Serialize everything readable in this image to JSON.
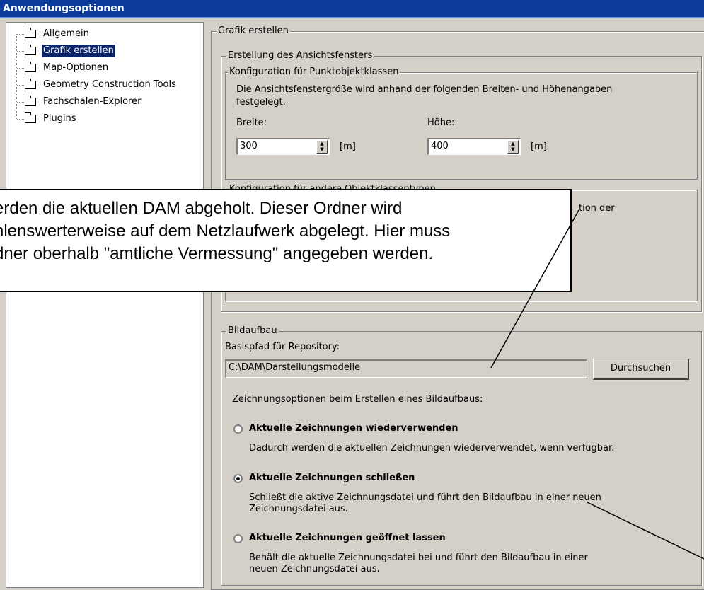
{
  "window": {
    "title": "Anwendungsoptionen"
  },
  "tree": {
    "items": [
      {
        "label": "Allgemein",
        "selected": false
      },
      {
        "label": "Grafik erstellen",
        "selected": true
      },
      {
        "label": "Map-Optionen",
        "selected": false
      },
      {
        "label": "Geometry Construction Tools",
        "selected": false
      },
      {
        "label": "Fachschalen-Explorer",
        "selected": false
      },
      {
        "label": "Plugins",
        "selected": false
      }
    ]
  },
  "main": {
    "group_title": "Grafik erstellen",
    "ansicht": {
      "title": "Erstellung des Ansichtsfensters",
      "punkt": {
        "title": "Konfiguration für Punktobjektklassen",
        "description_line1": "Die Ansichtsfenstergröße wird anhand der folgenden Breiten- und Höhenangaben",
        "description_line2": "festgelegt.",
        "width_label": "Breite:",
        "width_value": "300",
        "height_label": "Höhe:",
        "height_value": "400",
        "unit": "[m]"
      },
      "andere": {
        "title": "Konfiguration für andere Objektklassentypen",
        "partial_text": "tion der"
      }
    },
    "bildaufbau": {
      "title": "Bildaufbau",
      "repo_label": "Basispfad für Repository:",
      "repo_value": "C:\\DAM\\Darstellungsmodelle",
      "browse_button": "Durchsuchen",
      "options_label": "Zeichnungsoptionen beim Erstellen eines Bildaufbaus:",
      "options": [
        {
          "label": "Aktuelle Zeichnungen wiederverwenden",
          "description": [
            "Dadurch werden die aktuellen Zeichnungen wiederverwendet, wenn verfügbar."
          ],
          "checked": false
        },
        {
          "label": "Aktuelle Zeichnungen schließen",
          "description": [
            "Schließt die aktive Zeichnungsdatei und führt den Bildaufbau in einer neuen",
            "Zeichnungsdatei aus."
          ],
          "checked": true
        },
        {
          "label": "Aktuelle Zeichnungen geöffnet lassen",
          "description": [
            "Behält die aktuelle Zeichnungsdatei bei und führt den Bildaufbau in einer",
            "neuen Zeichnungsdatei aus."
          ],
          "checked": false
        }
      ]
    }
  },
  "callout": {
    "lines": [
      "erden die aktuellen DAM abgeholt. Dieser Ordner wird",
      "hlenswerterweise auf dem Netzlaufwerk abgelegt. Hier muss",
      "dner oberhalb \"amtliche Vermessung\" angegeben werden."
    ]
  }
}
